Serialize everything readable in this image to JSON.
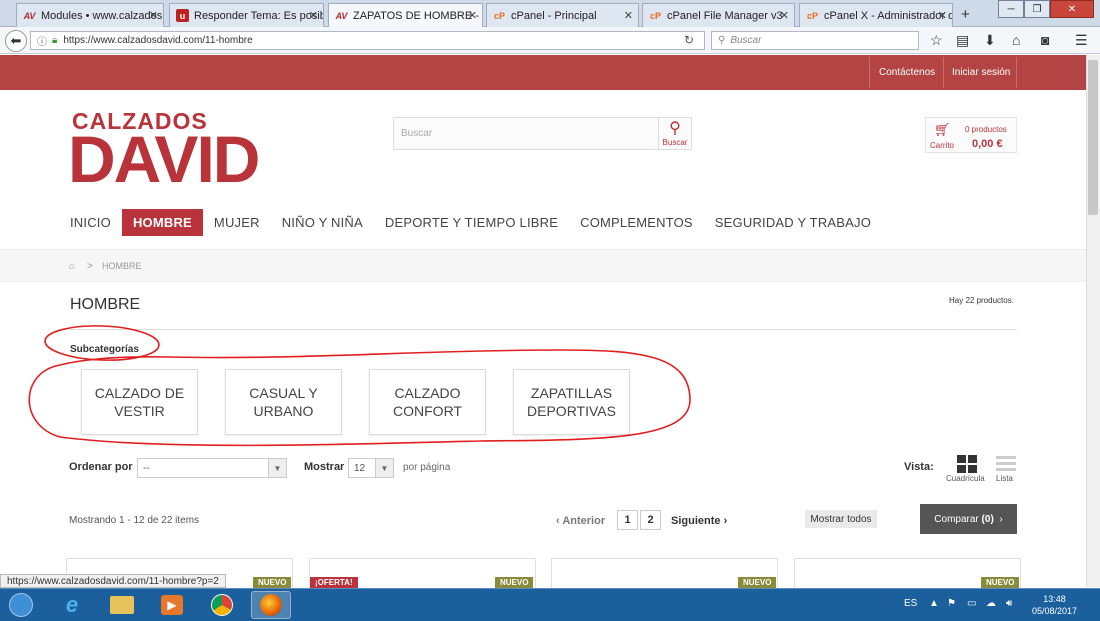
{
  "browser": {
    "tabs": [
      {
        "label": "Modules • www.calzados",
        "icon": "av-logo-icon"
      },
      {
        "label": "Responder Tema: Es posib",
        "icon": "u-logo-icon"
      },
      {
        "label": "ZAPATOS DE HOMBRE - v",
        "icon": "av-logo-icon",
        "active": true
      },
      {
        "label": "cPanel - Principal",
        "icon": "cpanel-icon"
      },
      {
        "label": "cPanel File Manager v3",
        "icon": "cpanel-icon"
      },
      {
        "label": "cPanel X - Administrador d",
        "icon": "cpanel-icon"
      }
    ],
    "new_tab": "+",
    "url": "https://www.calzadosdavid.com/11-hombre",
    "search_placeholder": "Buscar",
    "status_url": "https://www.calzadosdavid.com/11-hombre?p=2"
  },
  "site": {
    "top_links": {
      "contact": "Contáctenos",
      "login": "Iniciar sesión"
    },
    "logo": {
      "line1": "CALZADOS",
      "line2": "DAVID"
    },
    "search": {
      "placeholder": "Buscar",
      "button_label": "Buscar"
    },
    "cart": {
      "count": "0 productos",
      "label": "Carrito",
      "total": "0,00 €"
    },
    "menu": [
      "INICIO",
      "HOMBRE",
      "MUJER",
      "NIÑO Y NIÑA",
      "DEPORTE Y TIEMPO LIBRE",
      "COMPLEMENTOS",
      "SEGURIDAD Y TRABAJO"
    ],
    "breadcrumb": {
      "separator": ">",
      "current": "HOMBRE"
    },
    "page_title": "HOMBRE",
    "product_count": "Hay 22 productos.",
    "subcategories_label": "Subcategorías",
    "subcategories": [
      {
        "line1": "CALZADO DE",
        "line2": "VESTIR"
      },
      {
        "line1": "CASUAL Y",
        "line2": "URBANO"
      },
      {
        "line1": "CALZADO",
        "line2": "CONFORT"
      },
      {
        "line1": "ZAPATILLAS",
        "line2": "DEPORTIVAS"
      }
    ],
    "sort": {
      "label": "Ordenar por",
      "value": "--"
    },
    "show": {
      "label": "Mostrar",
      "value": "12",
      "suffix": "por página"
    },
    "view": {
      "label": "Vista:",
      "grid": "Cuadrícula",
      "list": "Lista"
    },
    "showing": "Mostrando 1 - 12 de 22 items",
    "pagination": {
      "prev": "Anterior",
      "pages": [
        "1",
        "2"
      ],
      "next": "Siguiente"
    },
    "show_all": "Mostrar todos",
    "compare": {
      "label": "Comparar",
      "count": "(0)"
    },
    "badges": {
      "new": "NUEVO",
      "offer": "¡OFERTA!"
    }
  },
  "taskbar": {
    "lang": "ES",
    "time": "13:48",
    "date": "05/08/2017"
  },
  "colors": {
    "brand": "#b8333a",
    "topbar": "#b44444",
    "taskbar": "#1b5f9c"
  }
}
